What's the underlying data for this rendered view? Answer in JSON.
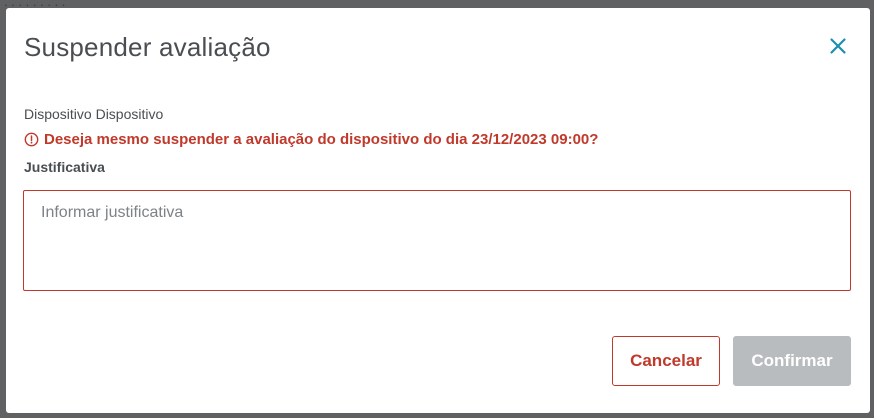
{
  "modal": {
    "title": "Suspender avaliação",
    "device_label": "Dispositivo Dispositivo",
    "warning_text": "Deseja mesmo suspender a avaliação do dispositivo do dia 23/12/2023 09:00?",
    "field_label": "Justificativa",
    "justification": {
      "value": "",
      "placeholder": "Informar justificativa"
    },
    "buttons": {
      "cancel_label": "Cancelar",
      "confirm_label": "Confirmar",
      "confirm_disabled": true
    },
    "close_icon": "close-icon",
    "warning_icon": "alert-circle-icon"
  },
  "colors": {
    "error": "#c0392b",
    "close_accent": "#1a8fb0",
    "disabled_button": "#b9bcbe",
    "title_text": "#4a4e52"
  }
}
